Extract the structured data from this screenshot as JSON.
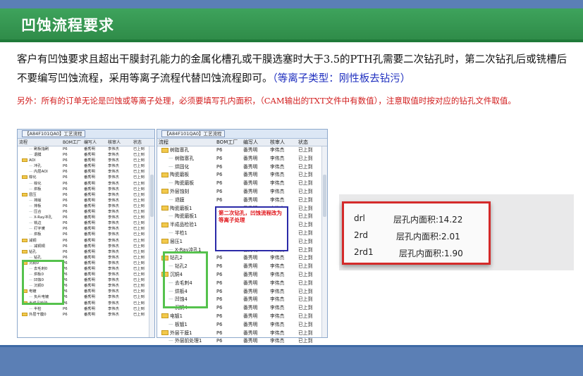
{
  "header": {
    "title": "凹蚀流程要求"
  },
  "paragraph1": {
    "text": "客户有凹蚀要求且超出干膜封孔能力的金属化槽孔或干膜选塞时大于3.5的PTH孔需要二次钻孔时，第二次钻孔后或铣槽后不要编写凹蚀流程，采用等离子流程代替凹蚀流程即可。",
    "blue": "（等离子类型：刚性板去钻污）"
  },
  "paragraph2": "另外：所有的订单无论是凹蚀或等离子处理，必须要填写孔内面积，（CAM输出的TXT文件中有数值），注意取值时按对应的钻孔文件取值。",
  "left_panel": {
    "title": "【A84F101QA0】工艺流程",
    "columns": [
      "流程",
      "BOM工厂",
      "编写人",
      "核审人",
      "状态"
    ],
    "rows": [
      [
        "刷板指刷",
        "P6",
        "番秀明",
        "李伟杰",
        "已上到"
      ],
      [
        "退膜",
        "P6",
        "番秀明",
        "李伟杰",
        "已上到"
      ],
      [
        "AOI",
        "P6",
        "番秀明",
        "李伟杰",
        "已上到"
      ],
      [
        "冲孔",
        "P6",
        "番秀明",
        "李伟杰",
        "已上到"
      ],
      [
        "内层AOI",
        "P6",
        "番秀明",
        "李伟杰",
        "已上到"
      ],
      [
        "棕化",
        "P6",
        "番秀明",
        "李伟杰",
        "已上到"
      ],
      [
        "棕化",
        "P6",
        "番秀明",
        "李伟杰",
        "已上到"
      ],
      [
        "烘板",
        "P6",
        "番秀明",
        "李伟杰",
        "已上到"
      ],
      [
        "层压",
        "P6",
        "番秀明",
        "李伟杰",
        "已上到"
      ],
      [
        "排版",
        "P6",
        "番秀明",
        "李伟杰",
        "已上到"
      ],
      [
        "排板",
        "P6",
        "番秀明",
        "李伟杰",
        "已上到"
      ],
      [
        "压合",
        "P6",
        "番秀明",
        "李伟杰",
        "已上到"
      ],
      [
        "X-Ray冲孔",
        "P6",
        "番秀明",
        "李伟杰",
        "已上到"
      ],
      [
        "铣边",
        "P6",
        "番秀明",
        "李伟杰",
        "已上到"
      ],
      [
        "打字唛",
        "P6",
        "番秀明",
        "李伟杰",
        "已上到"
      ],
      [
        "烘板",
        "P6",
        "番秀明",
        "李伟杰",
        "已上到"
      ],
      [
        "减铜",
        "P6",
        "番秀明",
        "李伟杰",
        "已上到"
      ],
      [
        "减铜铜",
        "P6",
        "番秀明",
        "李伟杰",
        "已上到"
      ],
      [
        "钻孔",
        "P6",
        "番秀明",
        "李伟杰",
        "已上到"
      ],
      [
        "钻孔",
        "P6",
        "番秀明",
        "李伟杰",
        "已上到"
      ],
      [
        "沉铜0",
        "P6",
        "番秀明",
        "李伟杰",
        "已上到"
      ],
      [
        "去毛刺0",
        "P6",
        "番秀明",
        "李伟杰",
        "已上到"
      ],
      [
        "烘板0",
        "P6",
        "番秀明",
        "李伟杰",
        "已上到"
      ],
      [
        "凹蚀0",
        "P6",
        "番秀明",
        "李伟杰",
        "已上到"
      ],
      [
        "沉铜0",
        "P6",
        "番秀明",
        "李伟杰",
        "已上到"
      ],
      [
        "电镀",
        "P6",
        "番秀明",
        "李伟杰",
        "已上到"
      ],
      [
        "负片电镀",
        "P6",
        "番秀明",
        "李伟杰",
        "已上到"
      ],
      [
        "半成品检验",
        "P6",
        "番秀明",
        "李伟杰",
        "已上到"
      ],
      [
        "半检",
        "P6",
        "番秀明",
        "李伟杰",
        "已上到"
      ],
      [
        "外层干膜0",
        "P6",
        "番秀明",
        "李伟杰",
        "已上到"
      ]
    ]
  },
  "right_panel": {
    "title": "【A84F101QA0】工艺流程",
    "columns": [
      "流程",
      "BOM工厂",
      "编写人",
      "核审人",
      "状态"
    ],
    "rows": [
      [
        "树脂塞孔",
        "P6",
        "番秀明",
        "李伟杰",
        "已上到"
      ],
      [
        "树脂塞孔",
        "P6",
        "番秀明",
        "李伟杰",
        "已上到"
      ],
      [
        "烘固化",
        "P6",
        "番秀明",
        "李伟杰",
        "已上到"
      ],
      [
        "陶瓷磨板",
        "P6",
        "番秀明",
        "李伟杰",
        "已上到"
      ],
      [
        "陶瓷磨板",
        "P6",
        "番秀明",
        "李伟杰",
        "已上到"
      ],
      [
        "外层蚀刻",
        "P6",
        "番秀明",
        "李伟杰",
        "已上到"
      ],
      [
        "退膜",
        "P6",
        "番秀明",
        "李伟杰",
        "已上到"
      ],
      [
        "陶瓷磨板1",
        "P6",
        "番秀明",
        "李伟杰",
        "已上到"
      ],
      [
        "陶瓷磨板1",
        "P6",
        "番秀明",
        "李伟杰",
        "已上到"
      ],
      [
        "半成品检验1",
        "P6",
        "番秀明",
        "李伟杰",
        "已上到"
      ],
      [
        "半检1",
        "P6",
        "番秀明",
        "李伟杰",
        "已上到"
      ],
      [
        "层压1",
        "P6",
        "番秀明",
        "李伟杰",
        "已上到"
      ],
      [
        "X-Ray冲孔1",
        "P6",
        "番秀明",
        "李伟杰",
        "已上到"
      ],
      [
        "钻孔2",
        "P6",
        "番秀明",
        "李伟杰",
        "已上到"
      ],
      [
        "钻孔2",
        "P6",
        "番秀明",
        "李伟杰",
        "已上到"
      ],
      [
        "沉铜4",
        "P6",
        "番秀明",
        "李伟杰",
        "已上到"
      ],
      [
        "去毛刺4",
        "P6",
        "番秀明",
        "李伟杰",
        "已上到"
      ],
      [
        "烘板4",
        "P6",
        "番秀明",
        "李伟杰",
        "已上到"
      ],
      [
        "凹蚀4",
        "P6",
        "番秀明",
        "李伟杰",
        "已上到"
      ],
      [
        "沉铜4",
        "P6",
        "番秀明",
        "李伟杰",
        "已上到"
      ],
      [
        "电镀1",
        "P6",
        "番秀明",
        "李伟杰",
        "已上到"
      ],
      [
        "板镀1",
        "P6",
        "番秀明",
        "李伟杰",
        "已上到"
      ],
      [
        "外层干膜1",
        "P6",
        "番秀明",
        "李伟杰",
        "已上到"
      ],
      [
        "外层前处理1",
        "P6",
        "番秀明",
        "李伟杰",
        "已上到"
      ]
    ]
  },
  "callout": "第二次钻孔，凹蚀流程改为等离子处理",
  "area_box": {
    "lines": [
      {
        "name": "drl",
        "value": "层孔内面积:14.22"
      },
      {
        "name": "2rd",
        "value": "层孔内面积:2.01"
      },
      {
        "name": "2rd1",
        "value": "层孔内面积:1.90"
      }
    ]
  }
}
